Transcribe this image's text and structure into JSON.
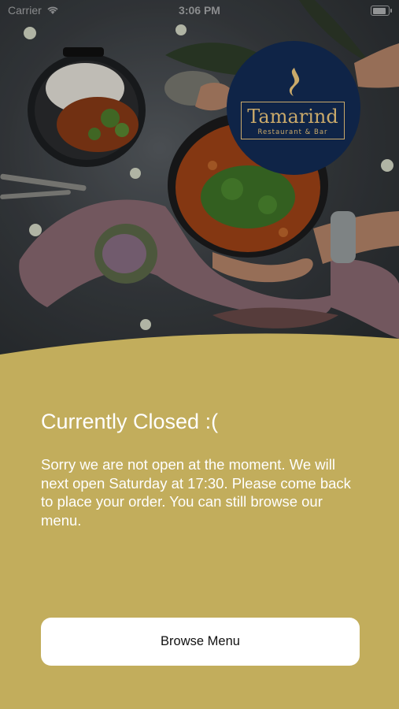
{
  "status_bar": {
    "carrier": "Carrier",
    "time": "3:06 PM"
  },
  "logo": {
    "name": "Tamarind",
    "subtitle": "Restaurant & Bar",
    "background": "#0f2447",
    "accent": "#c9a96a"
  },
  "closed_screen": {
    "title": "Currently Closed :(",
    "message": "Sorry we are not open at the moment. We will next open Saturday at 17:30. Please come back to place your order. You can still browse our menu.",
    "panel_color": "#c2ad5c"
  },
  "actions": {
    "browse_menu_label": "Browse Menu"
  }
}
